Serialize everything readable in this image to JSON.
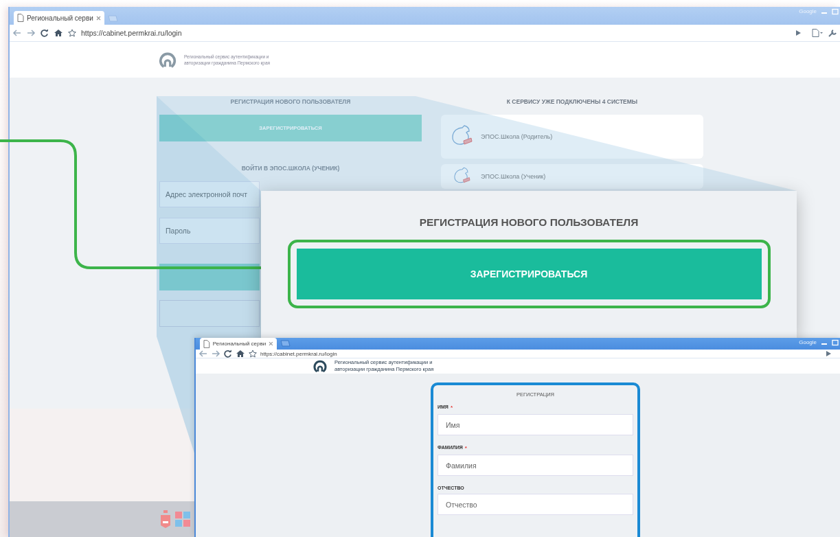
{
  "back_window": {
    "tab_title": "Региональный серви",
    "address": "https://cabinet.permkrai.ru/login",
    "frame_label": "Google",
    "header_text": "Региональный сервис аутентификации и авторизации гражданина Пермского края",
    "register_heading": "РЕГИСТРАЦИЯ НОВОГО ПОЛЬЗОВАТЕЛЯ",
    "register_button": "ЗАРЕГИСТРИРОВАТЬСЯ",
    "login_heading": "ВОЙТИ В ЭПОС.ШКОЛА (УЧЕНИК)",
    "login_fields": [
      {
        "placeholder": "Адрес электронной почт"
      },
      {
        "placeholder": "Пароль"
      }
    ],
    "systems_heading": "К СЕРВИСУ УЖЕ ПОДКЛЮЧЕНЫ 4 СИСТЕМЫ",
    "systems": [
      {
        "name": "ЭПОС.Школа (Родитель)"
      },
      {
        "name": "ЭПОС.Школа (Ученик)"
      }
    ]
  },
  "callout": {
    "heading": "РЕГИСТРАЦИЯ НОВОГО ПОЛЬЗОВАТЕЛЯ",
    "button": "ЗАРЕГИСТРИРОВАТЬСЯ"
  },
  "front_window": {
    "tab_title": "Региональный серви",
    "address": "https://cabinet.permkrai.ru/login",
    "frame_label": "Google",
    "header_text": "Региональный сервис аутентификации и авторизации гражданина Пермского края",
    "form": {
      "title": "РЕГИСТРАЦИЯ",
      "fields": [
        {
          "label": "ИМЯ",
          "required_mark": "*",
          "placeholder": "Имя"
        },
        {
          "label": "ФАМИЛИЯ",
          "required_mark": "*",
          "placeholder": "Фамилия"
        },
        {
          "label": "ОТЧЕСТВО",
          "placeholder": "Отчество"
        }
      ]
    }
  }
}
